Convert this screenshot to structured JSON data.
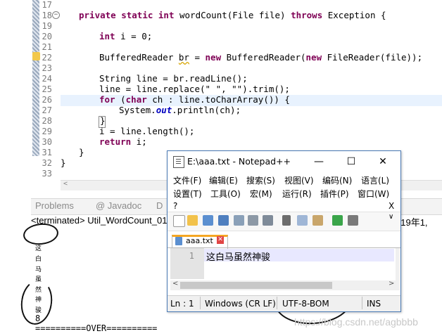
{
  "editor": {
    "line_numbers": [
      "17",
      "18",
      "19",
      "20",
      "21",
      "22",
      "23",
      "24",
      "25",
      "26",
      "27",
      "28",
      "29",
      "30",
      "31",
      "32",
      "33"
    ],
    "code": {
      "l18_kw1": "private",
      "l18_kw2": "static",
      "l18_kw3": "int",
      "l18_text": " wordCount(File file) ",
      "l18_kw4": "throws",
      "l18_text2": " Exception {",
      "l20_kw": "int",
      "l20_text": " i = 0;",
      "l22_text1": "BufferedReader ",
      "l22_var": "br",
      "l22_text2": " = ",
      "l22_kw": "new",
      "l22_text3": " BufferedReader(",
      "l22_kw2": "new",
      "l22_text4": " FileReader(file));",
      "l24_text": "String line = br.readLine();",
      "l25_text": "line = line.replace(\" \", \"\").trim();",
      "l26_kw1": "for",
      "l26_text1": " (",
      "l26_kw2": "char",
      "l26_text2": " ch : line.toCharArray()) {",
      "l27_text1": "System.",
      "l27_out": "out",
      "l27_text2": ".println(ch);",
      "l28_text": "}",
      "l29_text": "i = line.length();",
      "l30_kw": "return",
      "l30_text": " i;",
      "l31_text": "}",
      "l32_text": "}"
    }
  },
  "console": {
    "tabs": [
      "Problems",
      "@ Javadoc",
      "D"
    ],
    "header": "<terminated> Util_WordCount_01",
    "header_right": "019年1,",
    "output_chars": [
      "这",
      "白",
      "马",
      "虽",
      "然",
      "神",
      "骏"
    ],
    "output_number": "8",
    "output_over": "==========OVER=========="
  },
  "notepad": {
    "title": "E:\\aaa.txt - Notepad++",
    "window_buttons": {
      "minimize": "—",
      "maximize": "☐",
      "close": "✕"
    },
    "menu_row1": [
      "文件(F)",
      "编辑(E)",
      "搜索(S)",
      "视图(V)",
      "编码(N)",
      "语言(L)"
    ],
    "menu_row2": [
      "设置(T)",
      "工具(O)",
      "宏(M)",
      "运行(R)",
      "插件(P)",
      "窗口(W)"
    ],
    "menu_help": "?",
    "menu_close": "X",
    "tab_label": "aaa.txt",
    "tab_close": "✕",
    "line_number": "1",
    "content": "这白马虽然神骏",
    "status": {
      "position": "Ln : 1",
      "eol": "Windows (CR LF)",
      "encoding": "UTF-8-BOM",
      "mode": "INS"
    }
  },
  "watermark": "https://blog.csdn.net/agbbbb"
}
